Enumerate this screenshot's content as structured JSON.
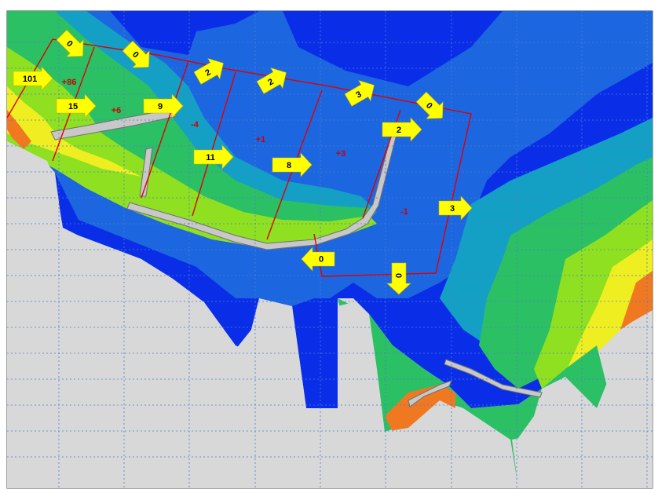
{
  "map": {
    "colors": {
      "land": "#d8d8d8",
      "deep": "#0020f0",
      "mid_deep": "#1060e0",
      "mid": "#10a0c8",
      "shallow": "#30c060",
      "shoal": "#90e020",
      "very_shoal": "#f0f020",
      "surf": "#f08020",
      "structure": "#c8c8c8",
      "cell_line": "#e00000",
      "arrow": "#ffff00",
      "budget_text": "#cc0000",
      "grid": "#4a7fd0"
    },
    "flux_arrows": [
      {
        "label": "101",
        "direction": "east"
      },
      {
        "label": "0",
        "direction": "southeast"
      },
      {
        "label": "0",
        "direction": "southeast"
      },
      {
        "label": "15",
        "direction": "east"
      },
      {
        "label": "9",
        "direction": "east"
      },
      {
        "label": "2",
        "direction": "northeast"
      },
      {
        "label": "2",
        "direction": "northeast"
      },
      {
        "label": "3",
        "direction": "northeast"
      },
      {
        "label": "0",
        "direction": "southeast"
      },
      {
        "label": "2",
        "direction": "east"
      },
      {
        "label": "11",
        "direction": "east"
      },
      {
        "label": "8",
        "direction": "east"
      },
      {
        "label": "3",
        "direction": "east"
      },
      {
        "label": "0",
        "direction": "west"
      },
      {
        "label": "0",
        "direction": "south"
      }
    ],
    "cell_budgets": [
      "+86",
      "+6",
      "-4",
      "+1",
      "+3",
      "-1"
    ]
  }
}
